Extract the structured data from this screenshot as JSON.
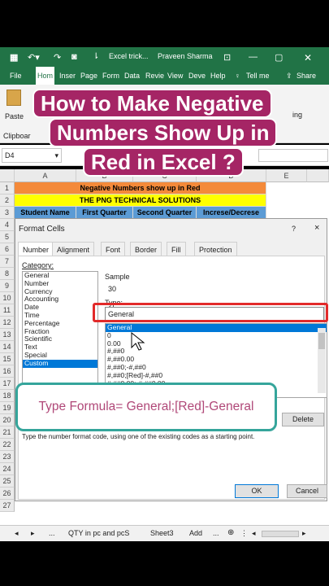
{
  "window": {
    "file_name": "Excel trick...",
    "user_name": "Praveen Sharma",
    "brand_color": "#217346"
  },
  "ribbon": {
    "tabs": [
      "File",
      "Hom",
      "Inser",
      "Page",
      "Form",
      "Data",
      "Revie",
      "View",
      "Deve",
      "Help"
    ],
    "active_tab": "Hom",
    "tell_me": "Tell me",
    "share": "Share",
    "paste_label": "Paste",
    "clipboard_label": "Clipboar",
    "editing_label": "ing"
  },
  "formula_bar": {
    "name_box": "D4"
  },
  "grid": {
    "columns": [
      "A",
      "B",
      "C",
      "D",
      "E"
    ],
    "rows": [
      "1",
      "2",
      "3",
      "4",
      "5",
      "6",
      "7",
      "8",
      "9",
      "10",
      "11",
      "12",
      "13",
      "14",
      "15",
      "16",
      "17",
      "18",
      "19",
      "20",
      "21",
      "22",
      "23",
      "24",
      "25",
      "26",
      "27"
    ],
    "row1_text": "Negative Numbers show up in Red",
    "row2_text": "THE PNG TECHNICAL SOLUTIONS",
    "headers": [
      "Student Name",
      "First Quarter",
      "Second Quarter",
      "Increse/Decrese"
    ],
    "colors": {
      "row1_bg": "#f48a3a",
      "row2_bg": "#ffff00",
      "header_bg": "#5b9bd5"
    }
  },
  "dialog": {
    "title": "Format Cells",
    "help": "?",
    "close": "×",
    "tabs": [
      "Number",
      "Alignment",
      "Font",
      "Border",
      "Fill",
      "Protection"
    ],
    "active_tab": "Number",
    "category_label": "Category:",
    "categories": [
      "General",
      "Number",
      "Currency",
      "Accounting",
      "Date",
      "Time",
      "Percentage",
      "Fraction",
      "Scientific",
      "Text",
      "Special",
      "Custom"
    ],
    "selected_category": "Custom",
    "sample_label": "Sample",
    "sample_value": "30",
    "type_label": "Type:",
    "type_value": "General",
    "formats": [
      "General",
      "0",
      "0.00",
      "#,##0",
      "#,##0.00",
      "#,##0;-#,##0",
      "#,##0;[Red]-#,##0",
      "#,##0.00;-#,##0.00"
    ],
    "delete_button": "Delete",
    "hint": "Type the number format code, using one of the existing codes as a starting point.",
    "ok_button": "OK",
    "cancel_button": "Cancel"
  },
  "overlay": {
    "caption_lines": [
      "How to Make Negative",
      "Numbers Show Up in",
      "Red in Excel ?"
    ],
    "caption_color": "#a52565",
    "formula_text": "Type Formula= General;[Red]-General",
    "callout_border": "#35a59b",
    "highlight_color": "#e22a2a"
  },
  "sheet_tabs": {
    "ellipsis": "...",
    "tabs": [
      "QTY in pc and pcS",
      "Sheet3",
      "Add"
    ],
    "more": "..."
  }
}
